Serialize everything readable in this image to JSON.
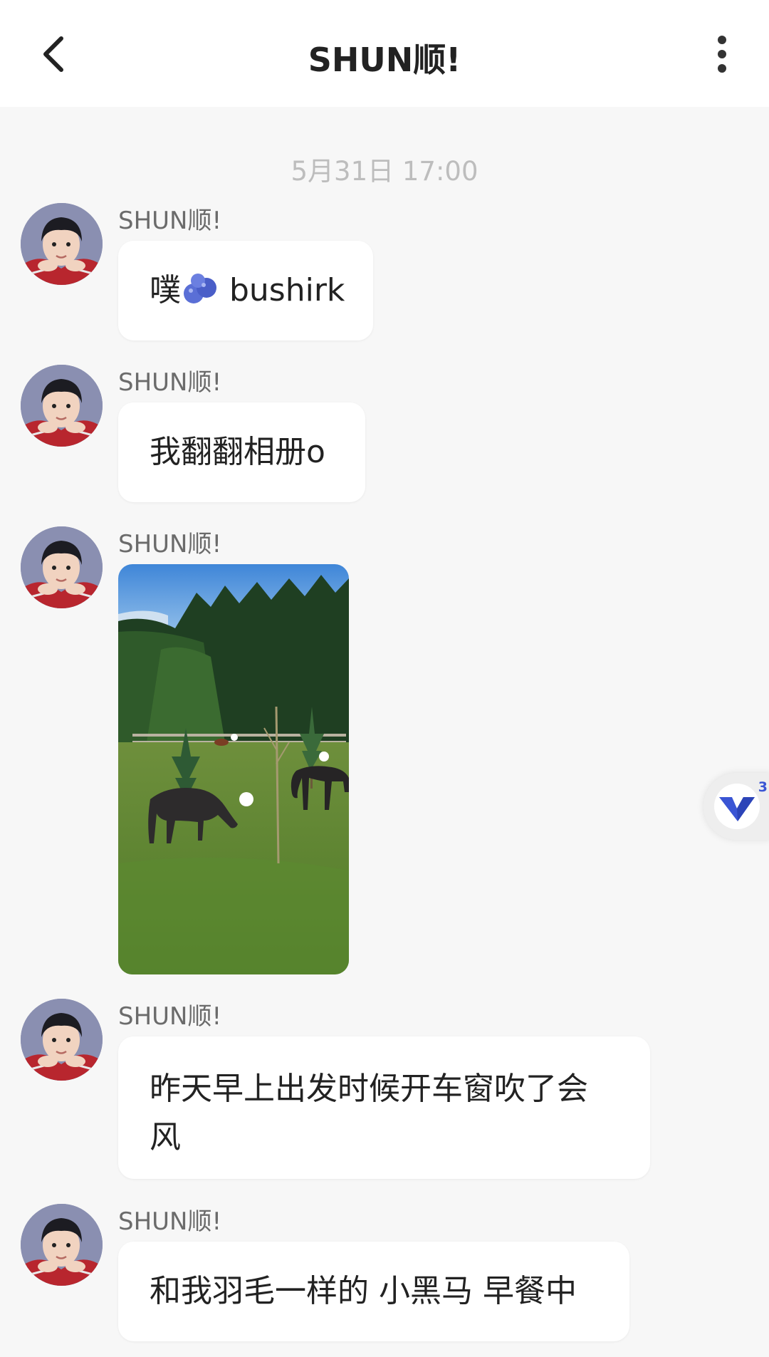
{
  "header": {
    "title": "SHUN顺!",
    "back_icon": "chevron-left-icon",
    "more_icon": "vertical-ellipsis-icon"
  },
  "chat": {
    "timestamp": "5月31日 17:00",
    "messages": [
      {
        "sender": "SHUN顺!",
        "type": "text",
        "text_before": "噗",
        "emoji": "blueberries-emoji",
        "text_after": " bushirk"
      },
      {
        "sender": "SHUN顺!",
        "type": "text",
        "text": "我翻翻相册o"
      },
      {
        "sender": "SHUN顺!",
        "type": "image",
        "image": "photo of dark horses grazing on a green meadow with pine trees"
      },
      {
        "sender": "SHUN顺!",
        "type": "text",
        "line1": "昨天早上出发时候开车窗吹了会",
        "line2": "风"
      },
      {
        "sender": "SHUN顺!",
        "type": "text",
        "text": "和我羽毛一样的 小黑马 早餐中"
      }
    ]
  },
  "floating_widget": {
    "icon": "v-logo-icon",
    "badge": "3"
  },
  "colors": {
    "background": "#f7f7f7",
    "bubble": "#ffffff",
    "accent": "#3a55d4"
  }
}
